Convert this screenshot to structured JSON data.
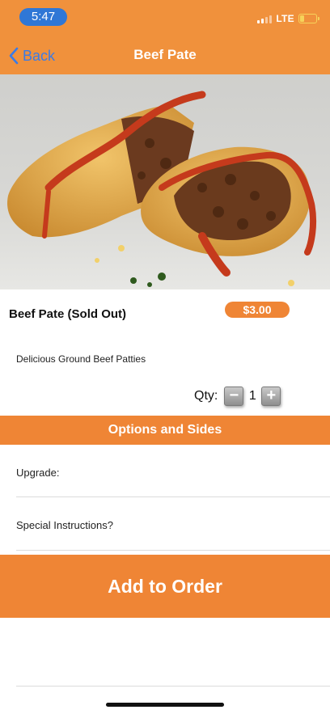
{
  "status_bar": {
    "time": "5:47",
    "network": "LTE",
    "battery_level": 0.25,
    "battery_color": "#f6d35a"
  },
  "nav": {
    "back_label": "Back",
    "title": "Beef Pate"
  },
  "hero_image": {
    "subject": "beef-pate-photo"
  },
  "product": {
    "name": "Beef Pate (Sold Out)",
    "price": "$3.00",
    "description": "Delicious Ground Beef Patties"
  },
  "quantity": {
    "label": "Qty:",
    "value": "1",
    "minus_icon": "minus-icon",
    "plus_icon": "plus-icon"
  },
  "options_section": {
    "title": "Options and Sides",
    "fields": [
      {
        "label": "Upgrade:"
      },
      {
        "label": "Special Instructions?"
      }
    ]
  },
  "cta": {
    "label": "Add to Order"
  },
  "colors": {
    "accent": "#ef8535",
    "header": "#f0913c",
    "link": "#3b7be6"
  }
}
